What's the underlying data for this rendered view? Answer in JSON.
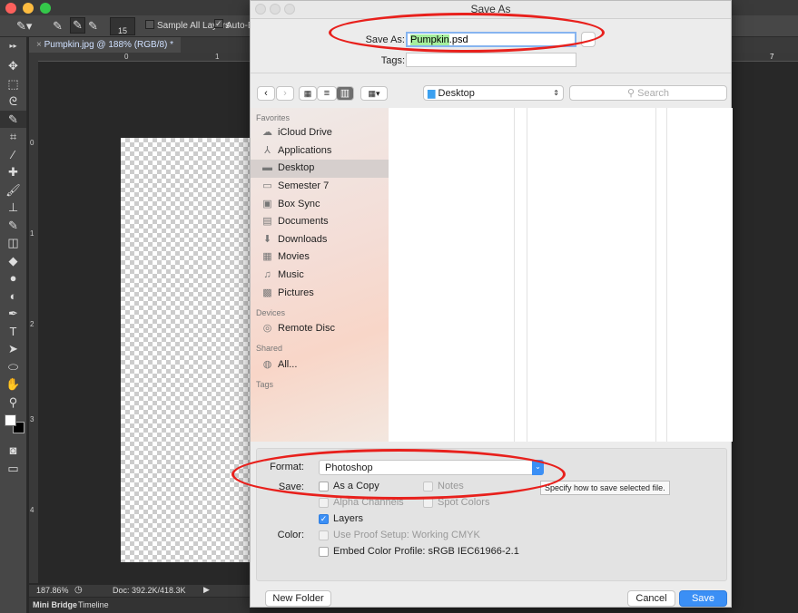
{
  "photoshop": {
    "options": {
      "brush_size": "15",
      "sample_all_layers": "Sample All Layers",
      "auto_enhance": "Auto-En"
    },
    "document_tab": "Pumpkin.jpg @ 188% (RGB/8) *",
    "ruler_h": [
      "0",
      "1",
      "7"
    ],
    "ruler_v": [
      "0",
      "1",
      "2",
      "3",
      "4"
    ],
    "status": {
      "zoom": "187.86%",
      "doc": "Doc: 392.2K/418.3K"
    },
    "bottom_tabs": [
      "Mini Bridge",
      "Timeline"
    ]
  },
  "dialog": {
    "title": "Save As",
    "save_as_label": "Save As:",
    "filename_selected": "Pumpkin",
    "filename_ext": ".psd",
    "tags_label": "Tags:",
    "location": "Desktop",
    "search_placeholder": "Search",
    "sidebar": {
      "favorites_label": "Favorites",
      "favorites": [
        {
          "label": "iCloud Drive",
          "icon": "cloud-icon"
        },
        {
          "label": "Applications",
          "icon": "applications-icon"
        },
        {
          "label": "Desktop",
          "icon": "desktop-icon",
          "selected": true
        },
        {
          "label": "Semester 7",
          "icon": "folder-icon"
        },
        {
          "label": "Box Sync",
          "icon": "box-icon"
        },
        {
          "label": "Documents",
          "icon": "documents-icon"
        },
        {
          "label": "Downloads",
          "icon": "downloads-icon"
        },
        {
          "label": "Movies",
          "icon": "movies-icon"
        },
        {
          "label": "Music",
          "icon": "music-icon"
        },
        {
          "label": "Pictures",
          "icon": "pictures-icon"
        }
      ],
      "devices_label": "Devices",
      "devices": [
        {
          "label": "Remote Disc",
          "icon": "disc-icon"
        }
      ],
      "shared_label": "Shared",
      "shared": [
        {
          "label": "All...",
          "icon": "network-icon"
        }
      ],
      "tags_label": "Tags"
    },
    "format_label": "Format:",
    "format_value": "Photoshop",
    "save_label": "Save:",
    "options": {
      "as_copy": "As a Copy",
      "notes": "Notes",
      "alpha": "Alpha Channels",
      "spot": "Spot Colors",
      "layers": "Layers"
    },
    "color_label": "Color:",
    "proof_setup": "Use Proof Setup:  Working CMYK",
    "embed_profile": "Embed Color Profile:  sRGB IEC61966-2.1",
    "tooltip": "Specify how to save selected file.",
    "new_folder": "New Folder",
    "cancel": "Cancel",
    "save": "Save"
  },
  "colors": {
    "accent": "#3b8ff5",
    "annotation": "#e8201c",
    "selection_highlight": "#a6ef9e"
  }
}
